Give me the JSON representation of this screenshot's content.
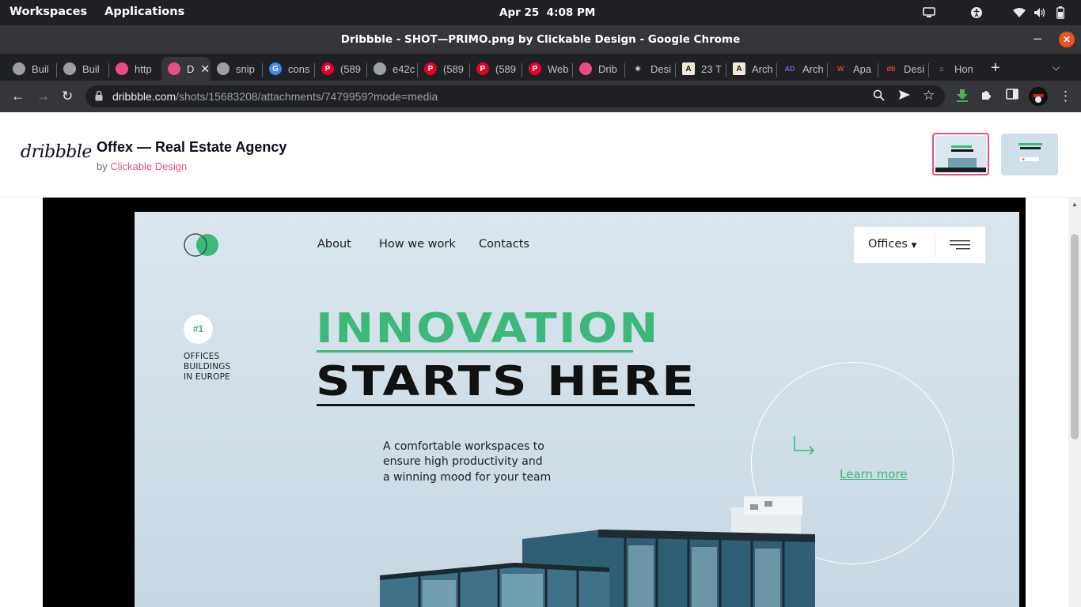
{
  "system_bar": {
    "workspaces": "Workspaces",
    "applications": "Applications",
    "date": "Apr 25",
    "time": "4:08 PM",
    "tray_icons": [
      "screen-icon",
      "accessibility-icon",
      "wifi-icon",
      "volume-icon",
      "battery-icon"
    ]
  },
  "window": {
    "title": "Dribbble - SHOT—PRIMO.png by Clickable Design - Google Chrome",
    "minimize": "–",
    "close": "✕"
  },
  "tabs": [
    {
      "label": "Buil",
      "icon": "globe-icon",
      "fav": "#9aa0a6"
    },
    {
      "label": "Buil",
      "icon": "globe-icon",
      "fav": "#9aa0a6"
    },
    {
      "label": "http",
      "icon": "dribbble-icon",
      "fav": "#ea4c89"
    },
    {
      "label": "D",
      "icon": "dribbble-icon",
      "fav": "#ea4c89",
      "active": true
    },
    {
      "label": "snip",
      "icon": "globe-icon",
      "fav": "#9aa0a6"
    },
    {
      "label": "cons",
      "icon": "google-icon",
      "fav": "#4285f4"
    },
    {
      "label": "(589",
      "icon": "pinterest-icon",
      "fav": "#e60023"
    },
    {
      "label": "e42c",
      "icon": "globe-icon",
      "fav": "#9aa0a6"
    },
    {
      "label": "(589",
      "icon": "pinterest-icon",
      "fav": "#e60023"
    },
    {
      "label": "(589",
      "icon": "pinterest-icon",
      "fav": "#e60023"
    },
    {
      "label": "Web",
      "icon": "pinterest-icon",
      "fav": "#e60023"
    },
    {
      "label": "Drib",
      "icon": "dribbble-icon",
      "fav": "#ea4c89"
    },
    {
      "label": "Desi",
      "icon": "asterisk-icon",
      "fav": "#202124"
    },
    {
      "label": "23 T",
      "icon": "letter-a-icon",
      "fav": "#f1ead8"
    },
    {
      "label": "Arch",
      "icon": "letter-a-icon",
      "fav": "#f1ead8"
    },
    {
      "label": "Arch",
      "icon": "ad-icon",
      "fav": "#202124"
    },
    {
      "label": "Apa",
      "icon": "wa-icon",
      "fav": "#202124"
    },
    {
      "label": "Desi",
      "icon": "dti-icon",
      "fav": "#202124"
    },
    {
      "label": "Hon",
      "icon": "home-icon",
      "fav": "#202124"
    }
  ],
  "toolbar": {
    "url_host": "dribbble.com",
    "url_path": "/shots/15683208/attachments/7479959?mode=media"
  },
  "dribbble": {
    "logo": "dribbble",
    "shot_title": "Offex — Real Estate Agency",
    "by": "by",
    "author": "Clickable Design"
  },
  "shot": {
    "nav": [
      "About",
      "How we work",
      "Contacts"
    ],
    "offices": "Offices",
    "badge": "#1",
    "badge_lines": [
      "OFFICES",
      "BUILDINGS",
      "IN EUROPE"
    ],
    "headline_1": "INNOVATION",
    "headline_2": "STARTS HERE",
    "copy": [
      "A comfortable workspaces to",
      "ensure high productivity and",
      "a winning mood for your team"
    ],
    "learn_more": "Learn more"
  },
  "colors": {
    "accent": "#3cb97a",
    "dribbble_pink": "#ea4c89"
  }
}
